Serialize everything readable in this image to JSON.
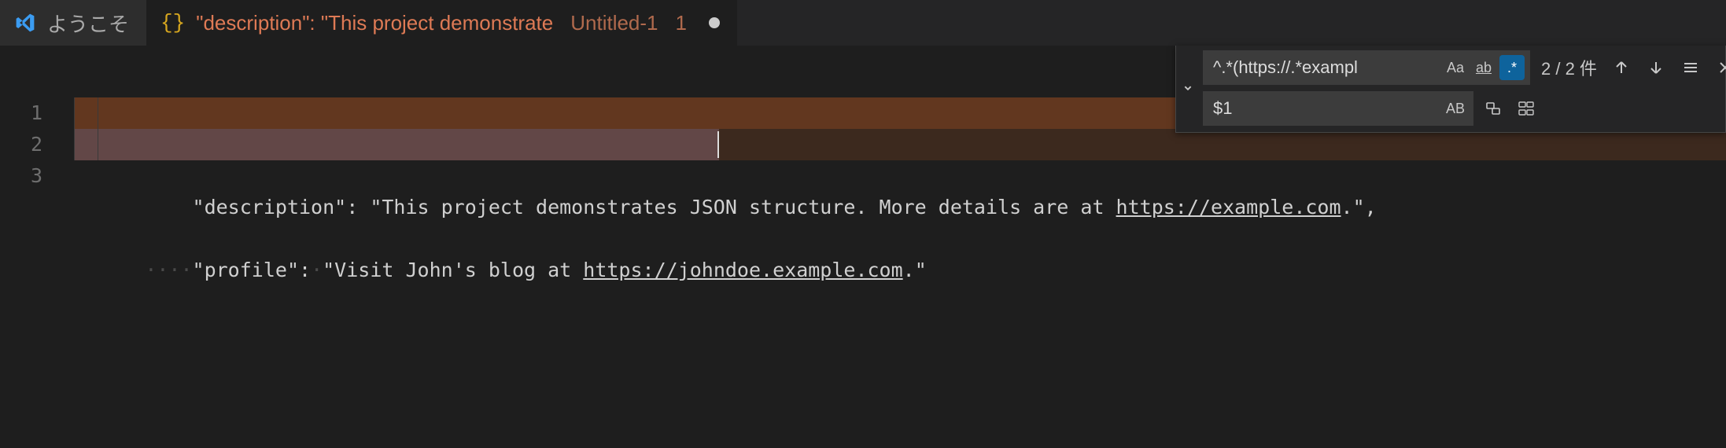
{
  "tabs": {
    "welcome": {
      "label": "ようこそ"
    },
    "active": {
      "title_main": "\"description\": \"This project demonstrate",
      "title_sub": "Untitled-1",
      "title_index": "1"
    }
  },
  "editor": {
    "line_numbers": [
      "1",
      "2",
      "3"
    ],
    "lines": {
      "l1": {
        "key": "\"description\"",
        "colon": ": ",
        "str_a": "\"This project demonstrates JSON structure. More details are at ",
        "url": "https://example.com",
        "str_b": ".\"",
        "trail": ","
      },
      "l2": {
        "key": "\"profile\"",
        "colon": ":",
        "str_a": "\"Visit John's blog at ",
        "url": "https://johndoe.example.com",
        "str_b": ".\""
      }
    }
  },
  "find": {
    "search_value": "^.*(https://.*exampl",
    "replace_value": "$1",
    "count_text": "2 / 2 件",
    "opt_case": "Aa",
    "opt_word": "ab",
    "opt_regex": ".*",
    "opt_preserve": "AB"
  }
}
